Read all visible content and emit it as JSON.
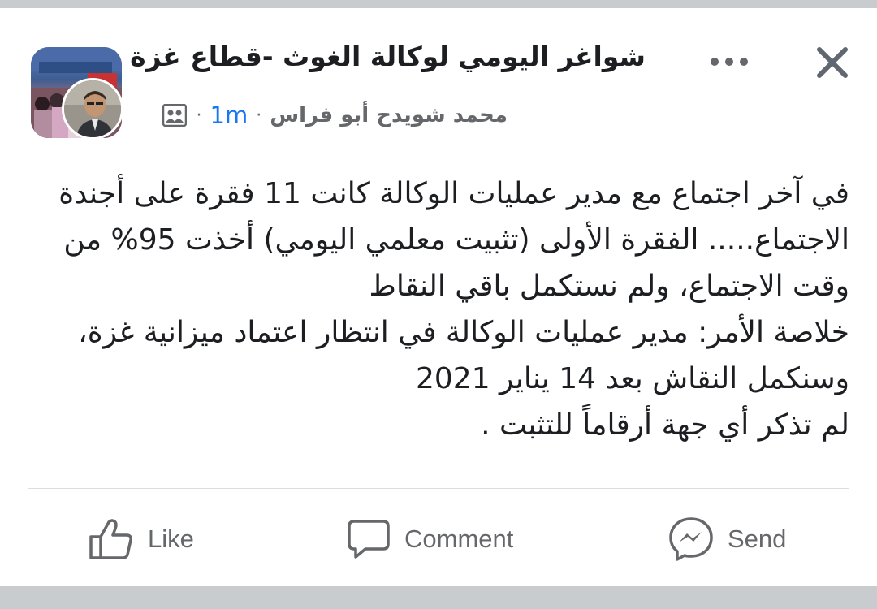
{
  "post": {
    "group_name": "شواغر اليومي لوكالة الغوث -قطاع غزة",
    "author": "محمد شويدح أبو فراس",
    "separator": "·",
    "timestamp": "1m",
    "privacy_icon": "group-members-icon",
    "body_lines": [
      "في آخر اجتماع مع مدير عمليات الوكالة كانت 11 فقرة على أجندة",
      "الاجتماع..... الفقرة الأولى (تثبيت معلمي اليومي) أخذت 95% من",
      "وقت الاجتماع، ولم نستكمل باقي النقاط",
      "خلاصة الأمر: مدير عمليات الوكالة في انتظار اعتماد ميزانية غزة،",
      "وسنكمل النقاش بعد 14 يناير 2021",
      "لم تذكر أي جهة أرقاماً للتثبت ."
    ]
  },
  "actions": {
    "like": "Like",
    "comment": "Comment",
    "send": "Send"
  },
  "colors": {
    "background": "#c9cccf",
    "card": "#ffffff",
    "text": "#1c1e21",
    "secondary": "#65676b",
    "timestamp": "#1877f2"
  }
}
